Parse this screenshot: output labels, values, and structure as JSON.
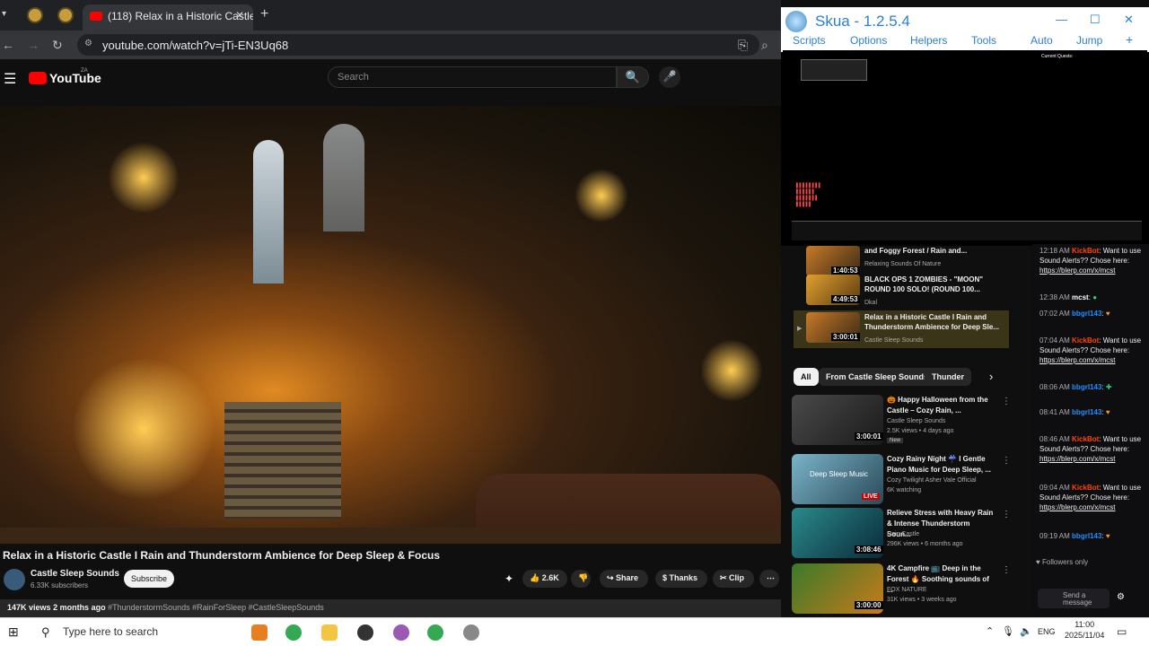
{
  "browser": {
    "tab_title": "(118) Relax in a Historic Castle",
    "url": "youtube.com/watch?v=jTi-EN3Uq68"
  },
  "youtube": {
    "logo": "YouTube",
    "region": "ZA",
    "search_placeholder": "Search",
    "video_title": "Relax in a Historic Castle I Rain and Thunderstorm Ambience for Deep Sleep & Focus",
    "channel_name": "Castle Sleep Sounds",
    "subscribers": "6.33K subscribers",
    "subscribe_label": "Subscribe",
    "likes": "2.6K",
    "share_label": "Share",
    "thanks_label": "Thanks",
    "clip_label": "Clip",
    "views": "147K views",
    "age": "2 months ago",
    "hashtags": "#ThunderstormSounds #RainForSleep #CastleSleepSounds"
  },
  "skua": {
    "title": "Skua - 1.2.5.4",
    "menu": [
      "Scripts",
      "Options",
      "Helpers",
      "Tools"
    ],
    "auto_label": "Auto",
    "jump_label": "Jump",
    "quest_header": "Current Quests:"
  },
  "playlist": [
    {
      "title": "and Foggy Forest / Rain and...",
      "channel": "Relaxing Sounds Of Nature",
      "duration": "1:40:53"
    },
    {
      "title": "BLACK OPS 1 ZOMBIES - \"MOON\" ROUND 100 SOLO! (ROUND 100...",
      "channel": "Dkal",
      "duration": "4:49:53"
    },
    {
      "title": "Relax in a Historic Castle I Rain and Thunderstorm Ambience for Deep Sle...",
      "channel": "Castle Sleep Sounds",
      "duration": "3:00:01"
    }
  ],
  "chips": [
    "All",
    "From Castle Sleep Sounds",
    "Thunder"
  ],
  "recommendations": [
    {
      "title": "🎃 Happy Halloween from the Castle – Cozy Rain, ...",
      "channel": "Castle Sleep Sounds",
      "meta": "2.5K views • 4 days ago",
      "badge": "New",
      "duration": "3:00:01"
    },
    {
      "title": "Cozy Rainy Night ☔ I Gentle Piano Music for Deep Sleep, ...",
      "channel": "Cozy Twilight Asher Vale Official",
      "meta": "6K watching",
      "badge": "LIVE",
      "thumb_text": "Deep Sleep Music"
    },
    {
      "title": "Relieve Stress with Heavy Rain & Intense Thunderstorm Soun...",
      "channel": "Rain Castle",
      "meta": "296K views • 6 months ago",
      "duration": "3:08:46"
    },
    {
      "title": "4K Campfire 📺 Deep in the Forest 🔥 Soothing sounds of ...",
      "channel": "FOX NATURE",
      "meta": "31K views • 3 weeks ago",
      "duration": "3:00:00"
    }
  ],
  "chat": [
    {
      "time": "12:18 AM",
      "user": "KickBot",
      "text": "Want to use Sound Alerts?? Chose here:",
      "link": "https://blerp.com/x/mcst"
    },
    {
      "time": "12:38 AM",
      "user": "mcst",
      "text": ""
    },
    {
      "time": "07:02 AM",
      "user": "bbgrl143",
      "text": ""
    },
    {
      "time": "07:04 AM",
      "user": "KickBot",
      "text": "Want to use Sound Alerts?? Chose here:",
      "link": "https://blerp.com/x/mcst"
    },
    {
      "time": "08:06 AM",
      "user": "bbgrl143",
      "text": ""
    },
    {
      "time": "08:41 AM",
      "user": "bbgrl143",
      "text": ""
    },
    {
      "time": "08:46 AM",
      "user": "KickBot",
      "text": "Want to use Sound Alerts?? Chose here:",
      "link": "https://blerp.com/x/mcst"
    },
    {
      "time": "09:04 AM",
      "user": "KickBot",
      "text": "Want to use Sound Alerts?? Chose here:",
      "link": "https://blerp.com/x/mcst"
    },
    {
      "time": "09:19 AM",
      "user": "bbgrl143",
      "text": ""
    }
  ],
  "chat_footer": {
    "followers_only": "Followers only",
    "input_placeholder": "Send a message"
  },
  "taskbar": {
    "search_placeholder": "Type here to search",
    "lang": "ENG",
    "time": "11:00",
    "date": "2025/11/04"
  },
  "colors": {
    "youtube_red": "#ff0000",
    "skua_blue": "#2a7fd4",
    "kickbot": "#ff4500"
  }
}
